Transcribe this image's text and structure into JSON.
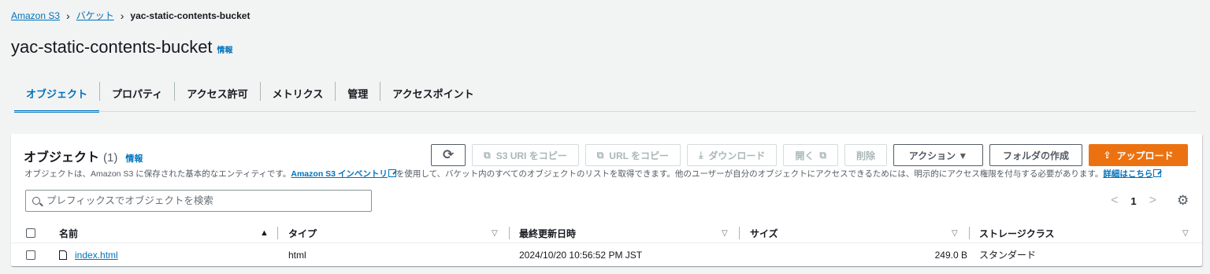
{
  "breadcrumb": {
    "root": "Amazon S3",
    "buckets": "バケット",
    "current": "yac-static-contents-bucket"
  },
  "page": {
    "title": "yac-static-contents-bucket",
    "info": "情報"
  },
  "tabs": [
    {
      "label": "オブジェクト",
      "active": true
    },
    {
      "label": "プロパティ"
    },
    {
      "label": "アクセス許可"
    },
    {
      "label": "メトリクス"
    },
    {
      "label": "管理"
    },
    {
      "label": "アクセスポイント"
    }
  ],
  "objects": {
    "title": "オブジェクト",
    "count": "(1)",
    "info": "情報",
    "desc_prefix": "オブジェクトは、Amazon S3 に保存された基本的なエンティティです。",
    "desc_link": "Amazon S3 インベントリ",
    "desc_middle": "を使用して、バケット内のすべてのオブジェクトのリストを取得できます。他のユーザーが自分のオブジェクトにアクセスできるためには、明示的にアクセス権限を付与する必要があります。",
    "desc_link2": "詳細はこちら",
    "toolbar": {
      "refresh": "C",
      "copy_s3_uri": "S3 URI をコピー",
      "copy_url": "URL をコピー",
      "download": "ダウンロード",
      "open": "開く",
      "delete": "削除",
      "actions": "アクション ▼",
      "create_folder": "フォルダの作成",
      "upload": "アップロード"
    },
    "search_placeholder": "プレフィックスでオブジェクトを検索",
    "pager": {
      "prev": "<",
      "page": "1",
      "next": ">"
    },
    "columns": {
      "name": "名前",
      "type": "タイプ",
      "modified": "最終更新日時",
      "size": "サイズ",
      "storage_class": "ストレージクラス"
    },
    "rows": [
      {
        "name": "index.html",
        "type": "html",
        "modified": "2024/10/20 10:56:52 PM JST",
        "size": "249.0 B",
        "storage_class": "スタンダード"
      }
    ]
  },
  "colors": {
    "link": "#0073bb",
    "primary": "#ec7211",
    "text": "#16191f"
  }
}
